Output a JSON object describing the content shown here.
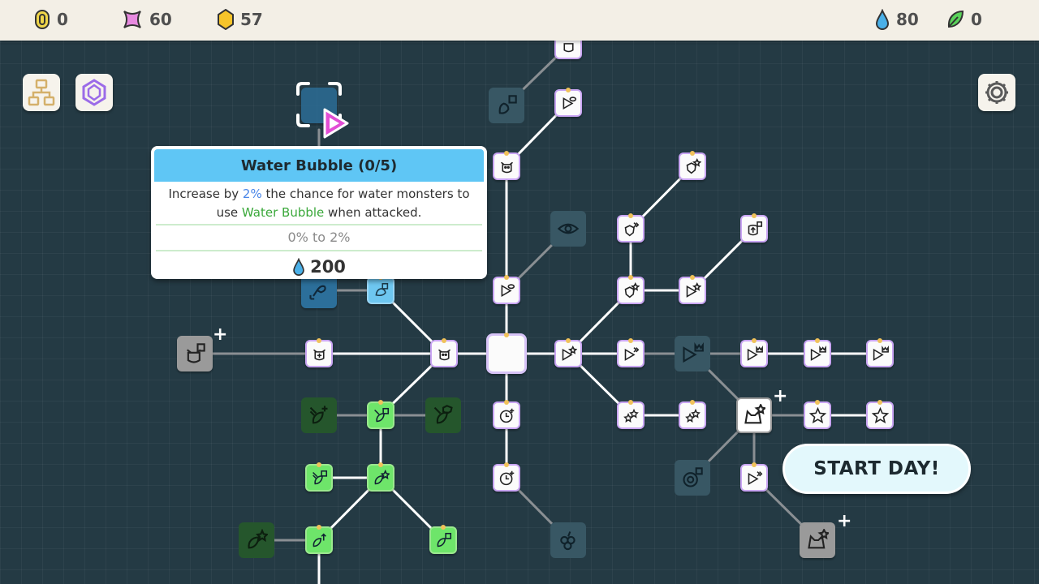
{
  "resources": {
    "coin": {
      "icon": "coin-icon",
      "value": "0",
      "color": "#f0d64a"
    },
    "gem": {
      "icon": "pink-star-icon",
      "value": "60",
      "color": "#e06ad8"
    },
    "crystal": {
      "icon": "gold-crystal-icon",
      "value": "57",
      "color": "#f6c42a"
    },
    "water": {
      "icon": "water-drop-icon",
      "value": "80",
      "color": "#4ab0e8"
    },
    "leaf": {
      "icon": "leaf-icon",
      "value": "0",
      "color": "#5ad35a"
    }
  },
  "tooltip": {
    "title": "Water Bubble (0/5)",
    "desc_1": "Increase by ",
    "desc_pct": "2%",
    "desc_2": " the chance for water monsters to",
    "desc_3": "use ",
    "desc_skill": "Water Bubble",
    "desc_4": " when attacked.",
    "range": "0% to 2%",
    "cost": "200",
    "cost_icon": "water-drop-icon"
  },
  "start_button": {
    "label": "START DAY!"
  },
  "colors": {
    "accent_blue": "#5fc6f5",
    "background": "#243a44",
    "node_border": "#c9a5f3"
  }
}
